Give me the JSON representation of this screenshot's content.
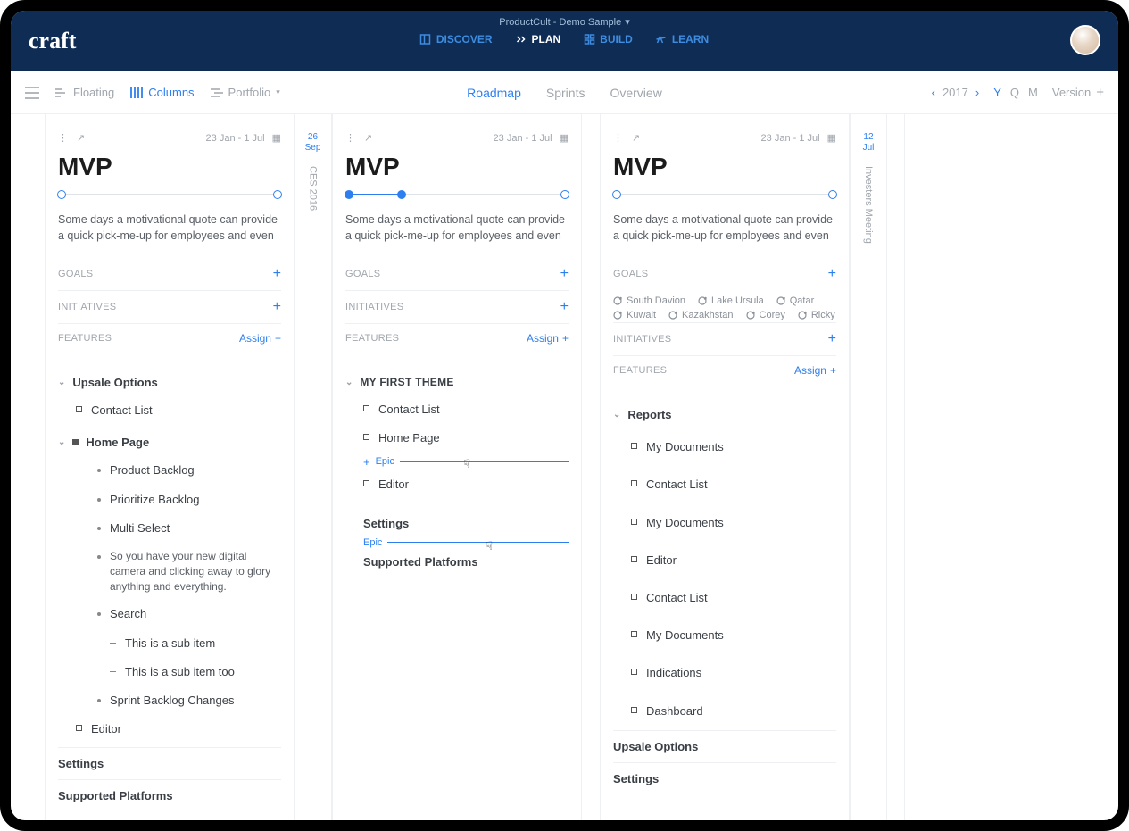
{
  "header": {
    "logo": "craft",
    "workspace": "ProductCult - Demo Sample",
    "nav": {
      "discover": "DISCOVER",
      "plan": "PLAN",
      "build": "BUILD",
      "learn": "LEARN"
    }
  },
  "toolbar": {
    "floating": "Floating",
    "columns": "Columns",
    "portfolio": "Portfolio",
    "tabs": {
      "roadmap": "Roadmap",
      "sprints": "Sprints",
      "overview": "Overview"
    },
    "year": "2017",
    "zoom": {
      "y": "Y",
      "q": "Q",
      "m": "M"
    },
    "version": "Version"
  },
  "strips": [
    {
      "date_top": "26",
      "date_bot": "Sep",
      "label": "CES 2016"
    },
    {
      "date_top": "12",
      "date_bot": "Jul",
      "label": "Investers Meeting"
    }
  ],
  "columns": [
    {
      "date_range": "23 Jan - 1 Jul",
      "title": "MVP",
      "progress": 0,
      "desc": "Some days a motivational quote can provide a quick pick-me-up for employees and even",
      "sections": {
        "goals": "GOALS",
        "initiatives": "INITIATIVES",
        "features": "FEATURES",
        "assign": "Assign"
      },
      "goal_chips": [],
      "tree": {
        "group1": "Upsale Options",
        "group1_items": [
          "Contact List"
        ],
        "group2": "Home Page",
        "group2_items": [
          "Product Backlog",
          "Prioritize Backlog",
          "Multi Select"
        ],
        "group2_long": "So you have your new digital camera and clicking away to glory anything and everything.",
        "group2_search": "Search",
        "group2_subs": [
          "This is a sub item",
          "This is a sub item too"
        ],
        "group2_last": "Sprint Backlog Changes",
        "group1_editor": "Editor",
        "settings": "Settings",
        "supported": "Supported Platforms"
      }
    },
    {
      "date_range": "23 Jan - 1 Jul",
      "title": "MVP",
      "progress": 25,
      "desc": "Some days a motivational quote can provide a quick pick-me-up for employees and even",
      "sections": {
        "goals": "GOALS",
        "initiatives": "INITIATIVES",
        "features": "FEATURES",
        "assign": "Assign"
      },
      "tree": {
        "theme": "MY FIRST THEME",
        "items": [
          "Contact List",
          "Home Page"
        ],
        "epic": "Epic",
        "editor": "Editor",
        "settings": "Settings",
        "epic2": "Epic",
        "supported": "Supported Platforms"
      }
    },
    {
      "date_range": "23 Jan - 1 Jul",
      "title": "MVP",
      "progress": 0,
      "desc": "Some days a motivational quote can provide a quick pick-me-up for employees and even",
      "sections": {
        "goals": "GOALS",
        "initiatives": "INITIATIVES",
        "features": "FEATURES",
        "assign": "Assign"
      },
      "goal_chips": [
        "South Davion",
        "Lake Ursula",
        "Qatar",
        "Kuwait",
        "Kazakhstan",
        "Corey",
        "Ricky"
      ],
      "tree": {
        "reports": "Reports",
        "items": [
          "My Documents",
          "Contact List",
          "My Documents",
          "Editor",
          "Contact List",
          "My Documents",
          "Indications",
          "Dashboard"
        ],
        "upsale": "Upsale Options",
        "settings": "Settings"
      }
    }
  ]
}
